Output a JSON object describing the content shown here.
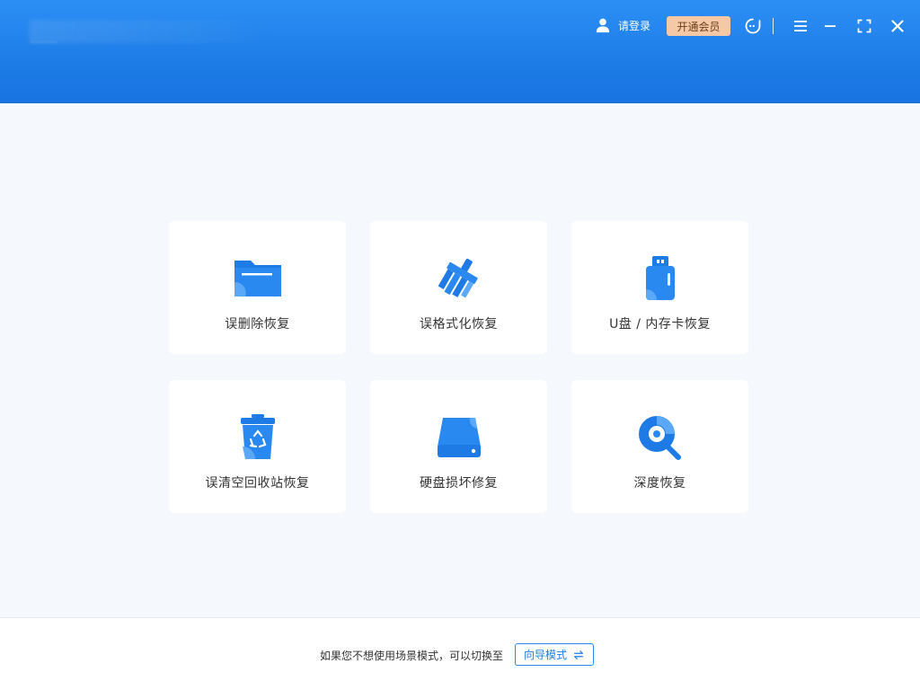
{
  "header": {
    "login_label": "请登录",
    "vip_label": "开通会员"
  },
  "cards": [
    {
      "label": "误删除恢复",
      "icon": "folder-icon"
    },
    {
      "label": "误格式化恢复",
      "icon": "broom-icon"
    },
    {
      "label": "U盘 / 内存卡恢复",
      "icon": "usb-drive-icon"
    },
    {
      "label": "误清空回收站恢复",
      "icon": "recycle-bin-icon"
    },
    {
      "label": "硬盘损坏修复",
      "icon": "hard-disk-icon"
    },
    {
      "label": "深度恢复",
      "icon": "deep-scan-icon"
    }
  ],
  "footer": {
    "hint_text": "如果您不想使用场景模式，可以切换至",
    "guide_button_label": "向导模式"
  },
  "colors": {
    "header_blue": "#1f7ee8",
    "accent_blue": "#2b86ee",
    "vip_bg": "#f6c9a6"
  }
}
